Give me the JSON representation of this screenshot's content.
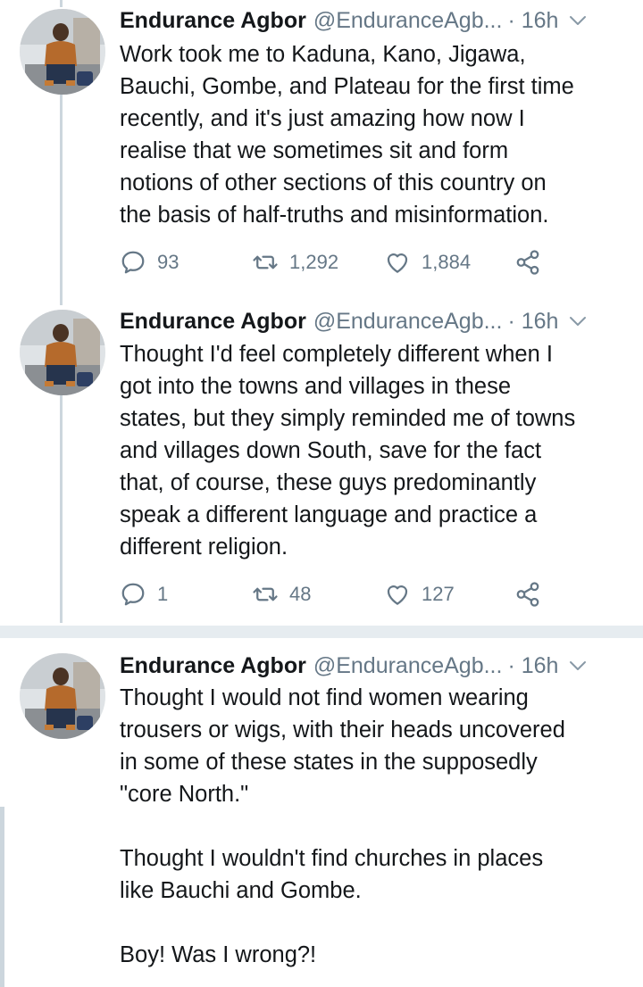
{
  "tweets": [
    {
      "name": "Endurance Agbor",
      "handle": "@EnduranceAgb...",
      "time": "· 16h",
      "text": "Work took me to Kaduna, Kano, Jigawa,\nBauchi, Gombe, and Plateau for the first time\nrecently, and it's just amazing how now I\nrealise that we sometimes sit and form\nnotions of other sections of this country on\nthe basis of half-truths and misinformation.",
      "replies": "93",
      "retweets": "1,292",
      "likes": "1,884"
    },
    {
      "name": "Endurance Agbor",
      "handle": "@EnduranceAgb...",
      "time": "· 16h",
      "text": "Thought I'd feel completely different when I\ngot into the towns and villages in these\nstates, but they simply reminded me of towns\nand villages down South, save for the fact\nthat, of course, these guys predominantly\nspeak a different language and practice a\ndifferent religion.",
      "replies": "1",
      "retweets": "48",
      "likes": "127"
    },
    {
      "name": "Endurance Agbor",
      "handle": "@EnduranceAgb...",
      "time": "· 16h",
      "text": "Thought I would not find women wearing\ntrousers or wigs, with their heads uncovered\nin some of these states in the supposedly\n\"core North.\"\n\nThought I wouldn't find churches in places\nlike Bauchi and Gombe.\n\nBoy! Was I wrong?!"
    }
  ],
  "icons": {
    "reply": "reply-icon",
    "retweet": "retweet-icon",
    "like": "heart-icon",
    "share": "share-icon",
    "more": "chevron-down-icon"
  },
  "colors": {
    "text": "#14171a",
    "secondary": "#657786",
    "thread_line": "#ccd6dd",
    "divider": "#e6ecf0"
  }
}
